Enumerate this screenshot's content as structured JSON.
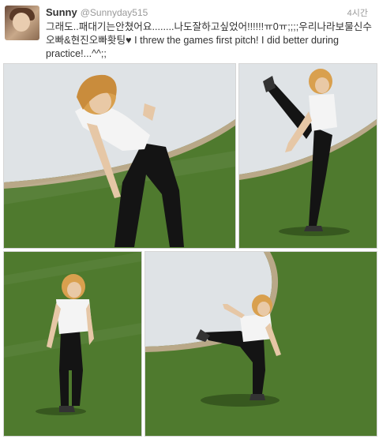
{
  "tweet": {
    "display_name": "Sunny",
    "handle": "@Sunnyday515",
    "time": "4시간",
    "text": "그래도..패대기는안쳤어요........나도잘하고싶었어!!!!!!ㅠ0ㅠ;;;;우리나라보물신수오빠&현진오빠홧팅♥ I threw the games first pitch! I did better during practice!...^^;;"
  },
  "colors": {
    "grass": "#4f7a2e",
    "mound": "#dfe3e6",
    "dirt": "#b9a888",
    "text": "#333333",
    "muted": "#999999"
  },
  "photos": [
    {
      "name": "photo-bending"
    },
    {
      "name": "photo-high-kick"
    },
    {
      "name": "photo-standing"
    },
    {
      "name": "photo-throwing"
    }
  ]
}
